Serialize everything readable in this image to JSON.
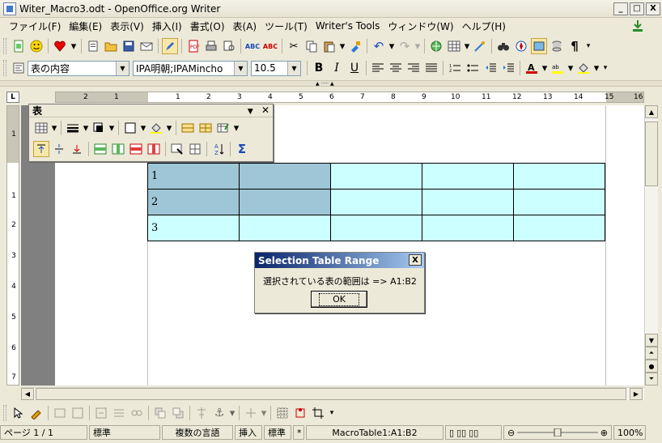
{
  "window": {
    "title": "Witer_Macro3.odt - OpenOffice.org Writer",
    "btn_min": "_",
    "btn_max": "□",
    "btn_close": "X"
  },
  "menu": {
    "items": [
      "ファイル(F)",
      "編集(E)",
      "表示(V)",
      "挿入(I)",
      "書式(O)",
      "表(A)",
      "ツール(T)",
      "Writer's Tools",
      "ウィンドウ(W)",
      "ヘルプ(H)"
    ]
  },
  "formatting": {
    "paragraph_style": "表の内容",
    "font_name": "IPA明朝;IPAMincho",
    "font_size": "10.5",
    "bold": "B",
    "italic": "I",
    "underline": "U"
  },
  "ruler": {
    "corner": "L",
    "h_numbers": [
      "2",
      "1",
      "1",
      "2",
      "3",
      "4",
      "5",
      "6",
      "7",
      "8",
      "9",
      "10",
      "11",
      "12",
      "13",
      "14",
      "15",
      "16"
    ],
    "v_numbers": [
      "1",
      "1",
      "2",
      "3",
      "4",
      "5",
      "6",
      "7"
    ]
  },
  "table_toolbar": {
    "title": "表",
    "pin": "▼",
    "close": "✕"
  },
  "document_table": {
    "rows": [
      [
        "1",
        "",
        "",
        "",
        ""
      ],
      [
        "2",
        "",
        "",
        "",
        ""
      ],
      [
        "3",
        "",
        "",
        "",
        ""
      ]
    ],
    "selection": "A1:B2"
  },
  "dialog": {
    "title": "Selection Table Range",
    "message": "選択されている表の範囲は  => A1:B2",
    "ok_label": "OK",
    "close": "X"
  },
  "statusbar": {
    "page": "ページ 1 / 1",
    "style": "標準",
    "language": "複数の言語",
    "insert_mode": "挿入",
    "selection_mode": "標準",
    "modified": "*",
    "cell_ref": "MacroTable1:A1:B2",
    "zoom": "100%"
  },
  "colors": {
    "cell_fill": "#ccffff",
    "cell_selected": "#9ec6d6",
    "dialog_title_start": "#0a246a",
    "dialog_title_end": "#a6caf0"
  }
}
